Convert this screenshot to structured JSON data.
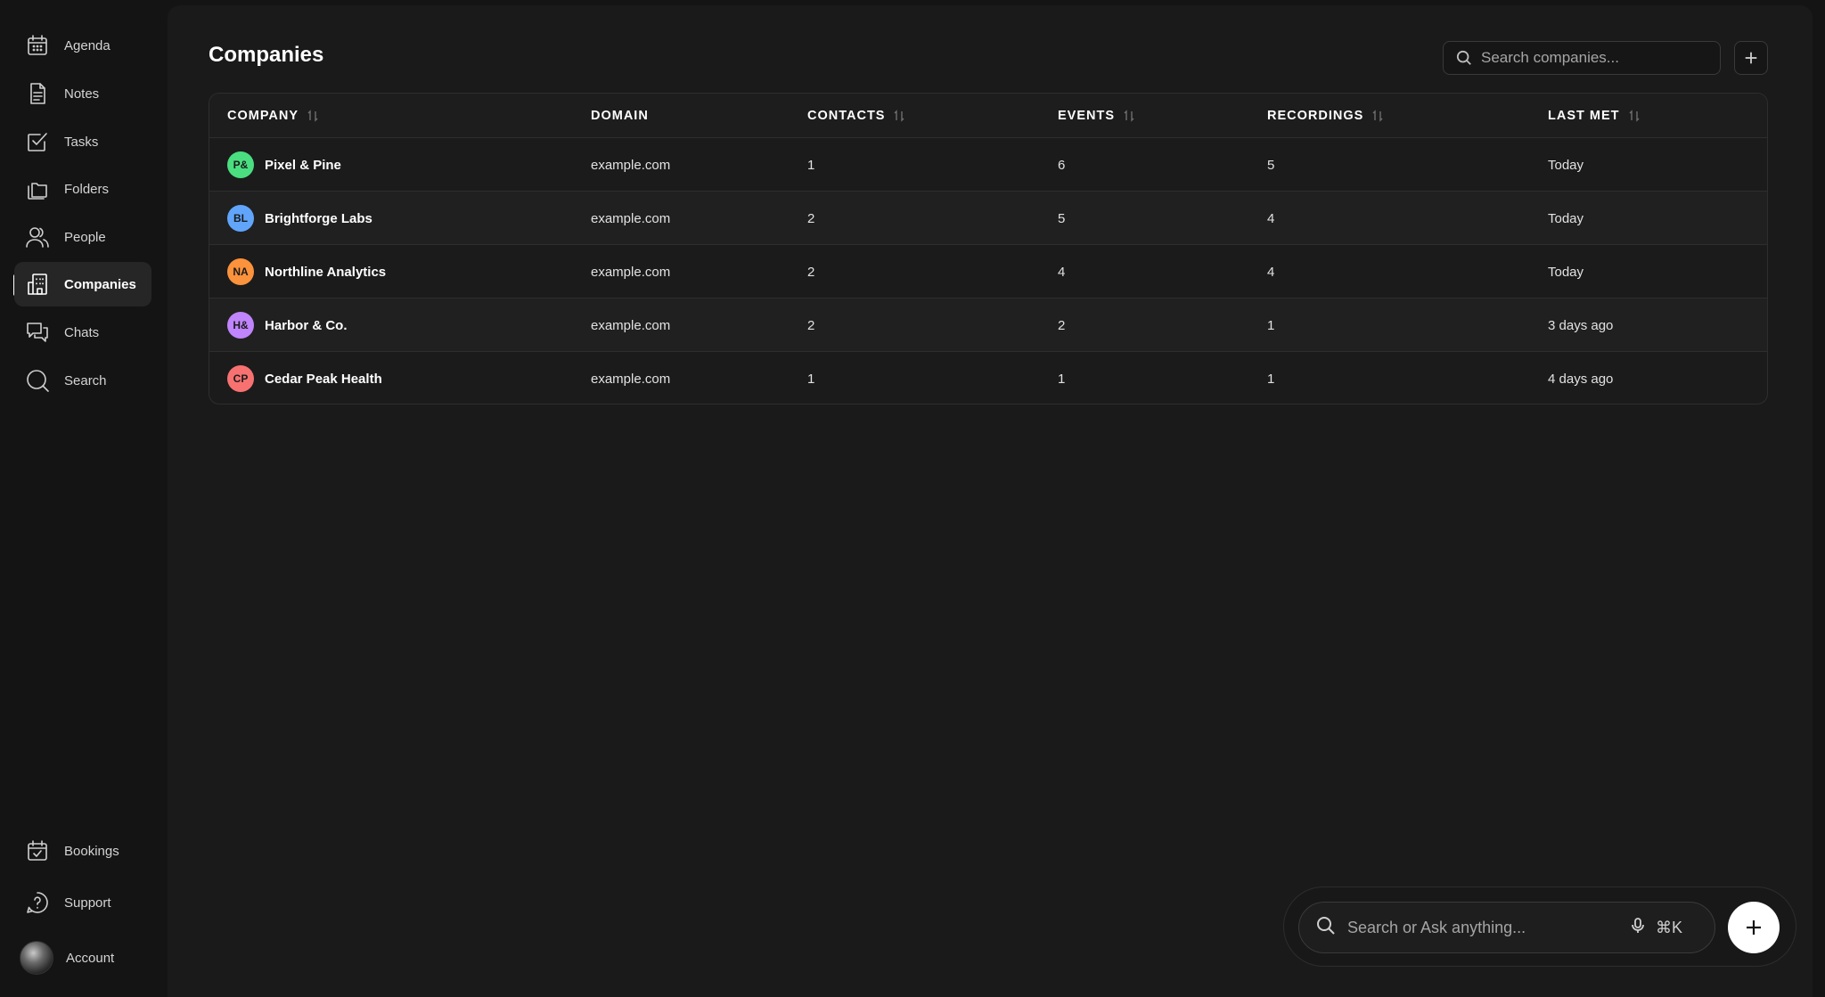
{
  "sidebar": {
    "top_items": [
      {
        "label": "Agenda",
        "icon": "calendar-icon"
      },
      {
        "label": "Notes",
        "icon": "document-icon"
      },
      {
        "label": "Tasks",
        "icon": "checkbox-icon"
      },
      {
        "label": "Folders",
        "icon": "folders-icon"
      },
      {
        "label": "People",
        "icon": "people-icon"
      },
      {
        "label": "Companies",
        "icon": "building-icon",
        "active": true
      },
      {
        "label": "Chats",
        "icon": "chat-icon"
      },
      {
        "label": "Search",
        "icon": "search-icon"
      }
    ],
    "bottom_items": [
      {
        "label": "Bookings",
        "icon": "calendar-check-icon"
      },
      {
        "label": "Support",
        "icon": "help-icon"
      },
      {
        "label": "Account",
        "icon": "avatar"
      }
    ]
  },
  "header": {
    "title": "Companies",
    "search_placeholder": "Search companies..."
  },
  "table": {
    "columns": [
      {
        "label": "COMPANY",
        "sortable": true
      },
      {
        "label": "DOMAIN",
        "sortable": false
      },
      {
        "label": "CONTACTS",
        "sortable": true
      },
      {
        "label": "EVENTS",
        "sortable": true
      },
      {
        "label": "RECORDINGS",
        "sortable": true
      },
      {
        "label": "LAST MET",
        "sortable": true
      }
    ],
    "rows": [
      {
        "initials": "P&",
        "color": "#4ade80",
        "name": "Pixel & Pine",
        "domain": "example.com",
        "contacts": "1",
        "events": "6",
        "recordings": "5",
        "last_met": "Today"
      },
      {
        "initials": "BL",
        "color": "#60a5fa",
        "name": "Brightforge Labs",
        "domain": "example.com",
        "contacts": "2",
        "events": "5",
        "recordings": "4",
        "last_met": "Today"
      },
      {
        "initials": "NA",
        "color": "#fb923c",
        "name": "Northline Analytics",
        "domain": "example.com",
        "contacts": "2",
        "events": "4",
        "recordings": "4",
        "last_met": "Today"
      },
      {
        "initials": "H&",
        "color": "#c084fc",
        "name": "Harbor & Co.",
        "domain": "example.com",
        "contacts": "2",
        "events": "2",
        "recordings": "1",
        "last_met": "3 days ago"
      },
      {
        "initials": "CP",
        "color": "#f87171",
        "name": "Cedar Peak Health",
        "domain": "example.com",
        "contacts": "1",
        "events": "1",
        "recordings": "1",
        "last_met": "4 days ago"
      }
    ]
  },
  "command_bar": {
    "placeholder": "Search or Ask anything...",
    "shortcut": "⌘K"
  }
}
